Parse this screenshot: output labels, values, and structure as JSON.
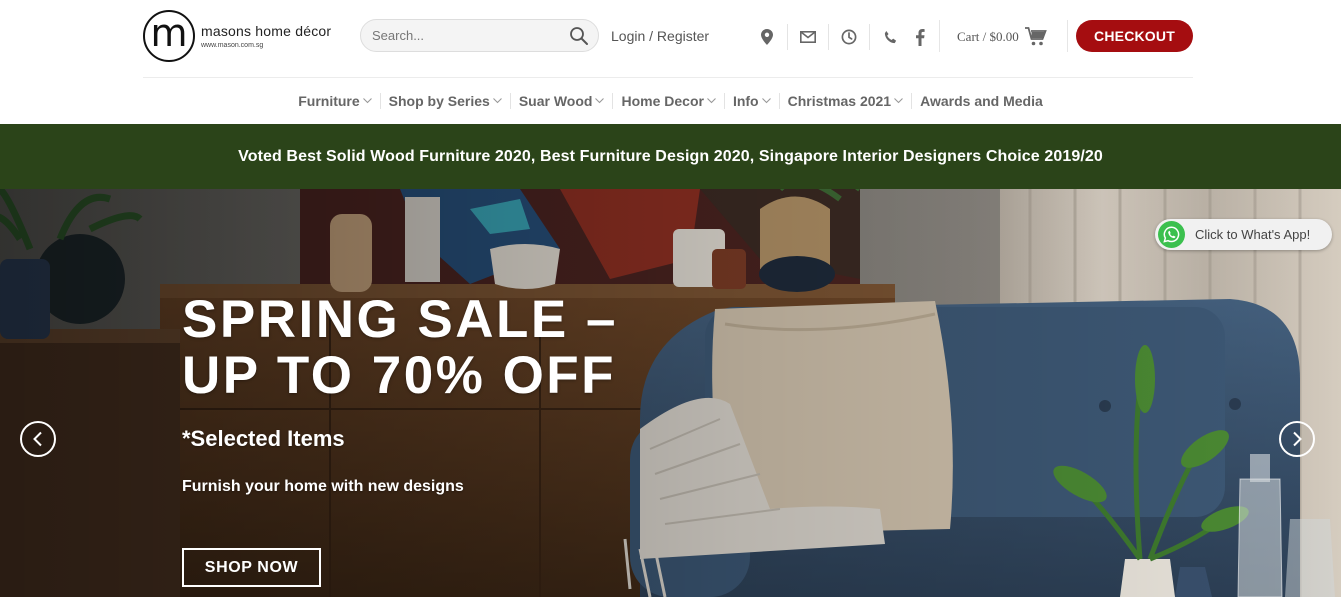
{
  "brand": {
    "logo_letter": "m",
    "name": "masons home décor",
    "url": "www.mason.com.sg"
  },
  "header": {
    "search_placeholder": "Search...",
    "login_label": "Login / Register",
    "cart_label": "Cart / $0.00",
    "checkout_label": "CHECKOUT",
    "icons": [
      "location-icon",
      "email-icon",
      "clock-icon",
      "phone-icon",
      "facebook-icon",
      "cart-icon",
      "search-icon"
    ]
  },
  "nav": {
    "items": [
      {
        "label": "Furniture",
        "has_dropdown": true
      },
      {
        "label": "Shop by Series",
        "has_dropdown": true
      },
      {
        "label": "Suar Wood",
        "has_dropdown": true
      },
      {
        "label": "Home Decor",
        "has_dropdown": true
      },
      {
        "label": "Info",
        "has_dropdown": true
      },
      {
        "label": "Christmas 2021",
        "has_dropdown": true
      },
      {
        "label": "Awards and Media",
        "has_dropdown": false
      }
    ]
  },
  "banner": {
    "text": "Voted Best Solid Wood Furniture 2020, Best Furniture Design 2020, Singapore Interior Designers Choice 2019/20",
    "color": "#2b4419"
  },
  "hero": {
    "title_line1": "SPRING SALE –",
    "title_line2": "UP TO 70% OFF",
    "subtitle": "*Selected Items",
    "text": "Furnish your home with new designs",
    "button_label": "SHOP NOW"
  },
  "whatsapp": {
    "label": "Click to What's App!"
  },
  "colors": {
    "accent": "#a50d10",
    "banner": "#2b4419",
    "whatsapp": "#3bc04e"
  }
}
